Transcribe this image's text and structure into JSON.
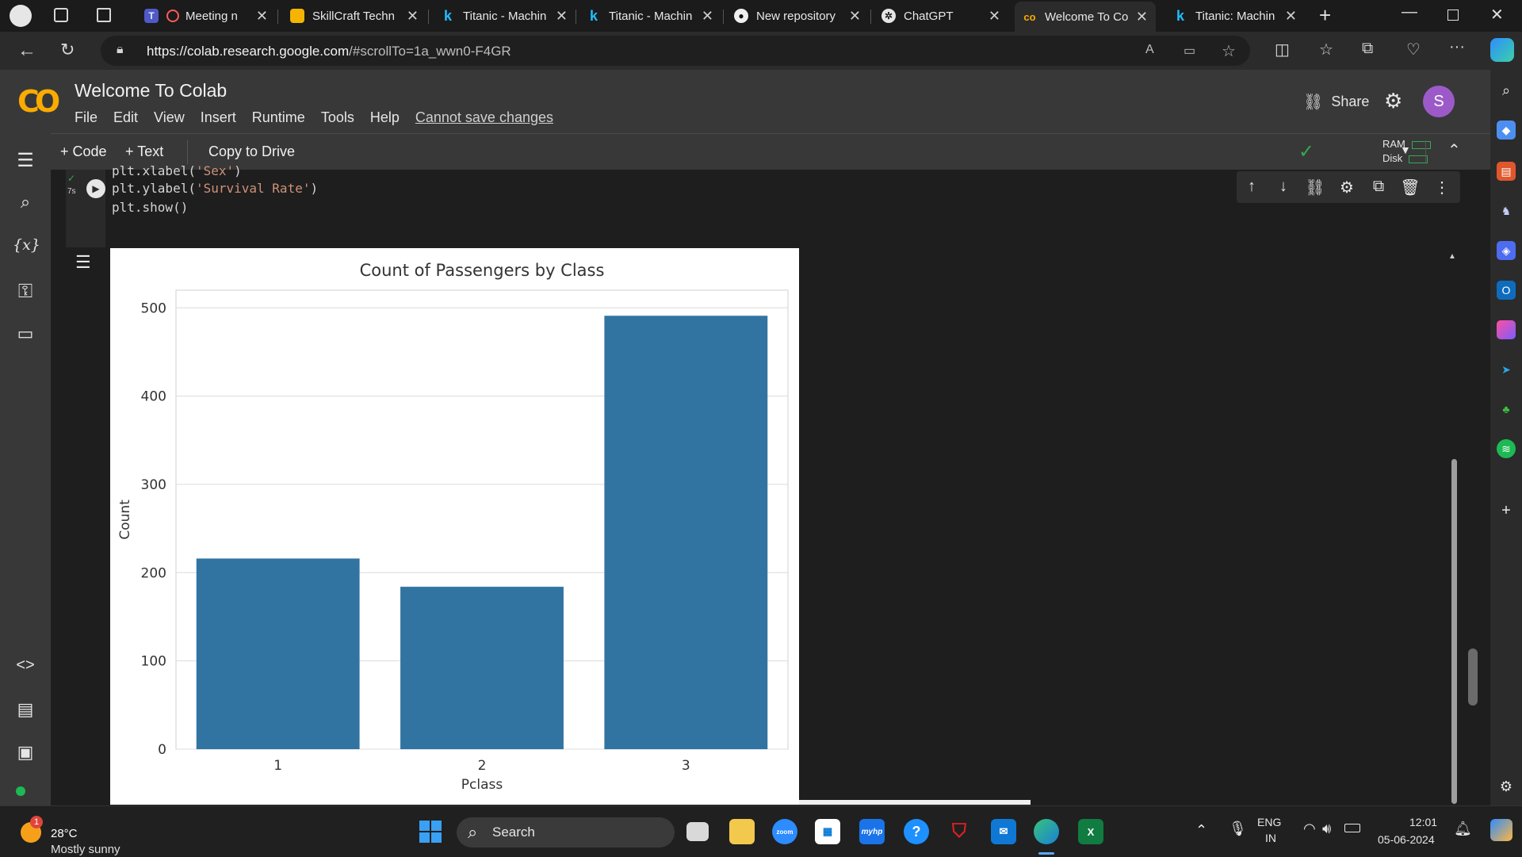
{
  "browser": {
    "tabs": [
      {
        "title": "Meeting n",
        "icon": "teams-icon"
      },
      {
        "title": "SkillCraft Techn",
        "icon": "slides-icon"
      },
      {
        "title": "Titanic - Machin",
        "icon": "kaggle-icon"
      },
      {
        "title": "Titanic - Machin",
        "icon": "kaggle-icon"
      },
      {
        "title": "New repository",
        "icon": "github-icon"
      },
      {
        "title": "ChatGPT",
        "icon": "chatgpt-icon"
      },
      {
        "title": "Welcome To Co",
        "icon": "colab-icon",
        "active": true
      },
      {
        "title": "Titanic: Machin",
        "icon": "kaggle-icon"
      }
    ],
    "url_host": "https://colab.research.google.com",
    "url_path": "/#scrollTo=1a_wwn0-F4GR"
  },
  "colab": {
    "title": "Welcome To Colab",
    "menu": [
      "File",
      "Edit",
      "View",
      "Insert",
      "Runtime",
      "Tools",
      "Help"
    ],
    "save_warning": "Cannot save changes",
    "share_label": "Share",
    "avatar_letter": "S",
    "toolbar": {
      "code": "+ Code",
      "text": "+ Text",
      "copy": "Copy to Drive"
    },
    "resources": {
      "ram": "RAM",
      "disk": "Disk"
    }
  },
  "cell": {
    "exec_time": "7s",
    "code_lines": [
      {
        "pre": "plt.xlabel(",
        "str": "'Sex'",
        "post": ")"
      },
      {
        "pre": "plt.ylabel(",
        "str": "'Survival Rate'",
        "post": ")"
      },
      {
        "pre": "plt.show()",
        "str": "",
        "post": ""
      }
    ]
  },
  "chart_data": {
    "type": "bar",
    "title": "Count of Passengers by Class",
    "xlabel": "Pclass",
    "ylabel": "Count",
    "categories": [
      "1",
      "2",
      "3"
    ],
    "values": [
      216,
      184,
      491
    ],
    "ylim": [
      0,
      520
    ],
    "yticks": [
      0,
      100,
      200,
      300,
      400,
      500
    ],
    "bar_color": "#3274a1",
    "grid": "horizontal"
  },
  "taskbar": {
    "weather_temp": "28°C",
    "weather_desc": "Mostly sunny",
    "weather_badge": "1",
    "search_label": "Search",
    "lang_top": "ENG",
    "lang_bottom": "IN",
    "time": "12:01",
    "date": "05-06-2024"
  }
}
